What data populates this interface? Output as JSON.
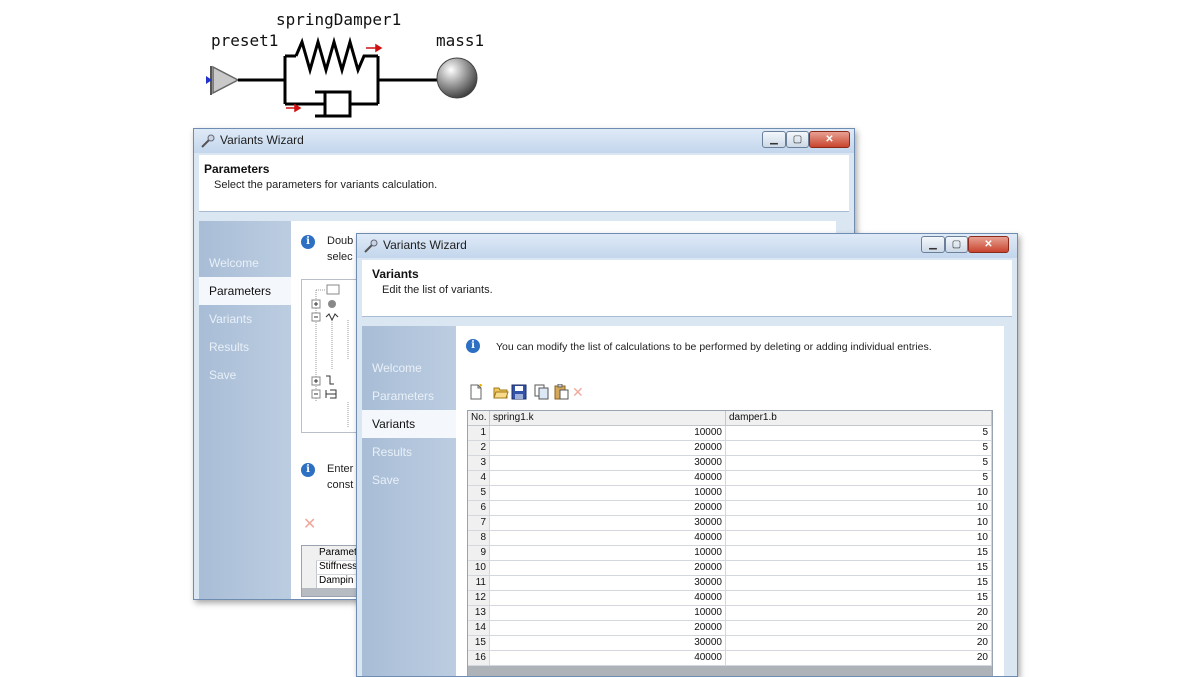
{
  "schematic": {
    "labels": {
      "preset": "preset1",
      "spring_damper": "springDamper1",
      "mass": "mass1"
    }
  },
  "windows": {
    "back": {
      "title": "Variants Wizard",
      "header_title": "Parameters",
      "header_subtitle": "Select the parameters for variants calculation.",
      "nav": [
        "Welcome",
        "Parameters",
        "Variants",
        "Results",
        "Save"
      ],
      "active_nav": "Parameters",
      "info1": "Doub",
      "info1b": "selec",
      "info2": "Enter",
      "info2b": "const",
      "table_rows": [
        "Paramet",
        "Stiffness",
        "Dampin"
      ]
    },
    "front": {
      "title": "Variants Wizard",
      "header_title": "Variants",
      "header_subtitle": "Edit the list of variants.",
      "nav": [
        "Welcome",
        "Parameters",
        "Variants",
        "Results",
        "Save"
      ],
      "active_nav": "Variants",
      "info": "You can modify the list of calculations to be performed by deleting or adding individual entries.",
      "table": {
        "headers": [
          "No.",
          "spring1.k",
          "damper1.b"
        ],
        "rows": [
          [
            "1",
            "10000",
            "5"
          ],
          [
            "2",
            "20000",
            "5"
          ],
          [
            "3",
            "30000",
            "5"
          ],
          [
            "4",
            "40000",
            "5"
          ],
          [
            "5",
            "10000",
            "10"
          ],
          [
            "6",
            "20000",
            "10"
          ],
          [
            "7",
            "30000",
            "10"
          ],
          [
            "8",
            "40000",
            "10"
          ],
          [
            "9",
            "10000",
            "15"
          ],
          [
            "10",
            "20000",
            "15"
          ],
          [
            "11",
            "30000",
            "15"
          ],
          [
            "12",
            "40000",
            "15"
          ],
          [
            "13",
            "10000",
            "20"
          ],
          [
            "14",
            "20000",
            "20"
          ],
          [
            "15",
            "30000",
            "20"
          ],
          [
            "16",
            "40000",
            "20"
          ]
        ]
      }
    }
  },
  "icons": {
    "toolbar": [
      "new-icon",
      "open-folder-icon",
      "save-icon",
      "copy-icon",
      "paste-icon",
      "delete-icon"
    ],
    "colors": {
      "accent": "#2d6fc2",
      "sidebar": "#b3c6dc",
      "close": "#c8452e",
      "delete": "#e0341e"
    }
  }
}
